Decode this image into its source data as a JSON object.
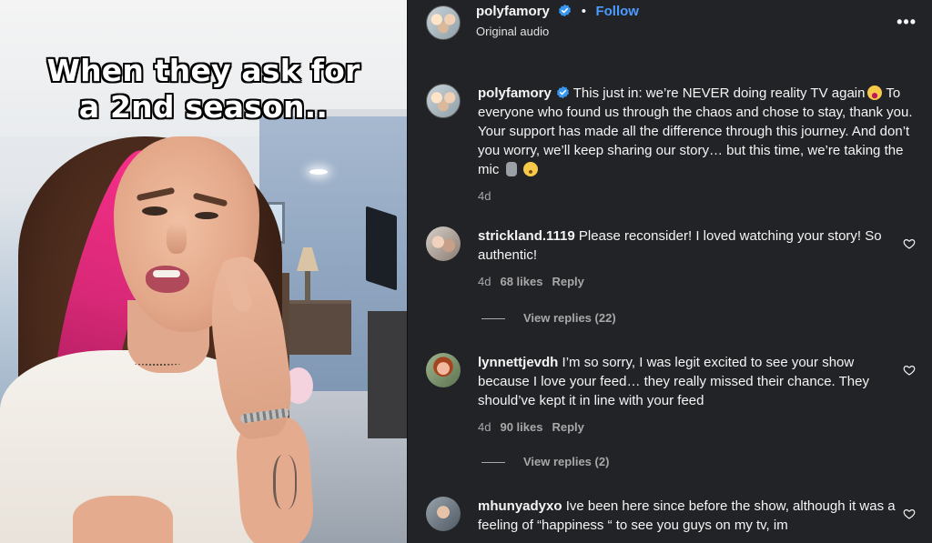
{
  "video": {
    "caption_line1": "When they ask for",
    "caption_line2": "a 2nd season.."
  },
  "post": {
    "username": "polyfamory",
    "follow_label": "Follow",
    "dot": "•",
    "audio": "Original audio",
    "more_icon": "•••",
    "caption_text": "This just in: we’re NEVER doing reality TV again",
    "caption_body": "To everyone who found us through the chaos and chose to stay, thank you. Your support has made all the difference through this journey. And don’t you worry, we’ll keep sharing our story… but this time, we’re taking the mic",
    "time": "4d"
  },
  "comments": [
    {
      "username": "strickland.1119",
      "text": "Please reconsider! I loved watching your story! So authentic!",
      "time": "4d",
      "likes": "68 likes",
      "reply_label": "Reply",
      "view_replies": "View replies (22)"
    },
    {
      "username": "lynnettjevdh",
      "text": "I’m so sorry, I was legit excited to see your show because I love your feed… they really missed their chance. They should’ve kept it in line with your feed",
      "time": "4d",
      "likes": "90 likes",
      "reply_label": "Reply",
      "view_replies": "View replies (2)"
    },
    {
      "username": "mhunyadyxo",
      "text": "Ive been here since before the show, although it was a feeling of “happiness “ to see you guys on my tv, im"
    }
  ],
  "colors": {
    "panel_bg": "#222327",
    "follow_blue": "#4d9bff",
    "verified_blue": "#3897f0",
    "muted": "#a8a8a8",
    "pink_hair": "#ff2f8e"
  }
}
